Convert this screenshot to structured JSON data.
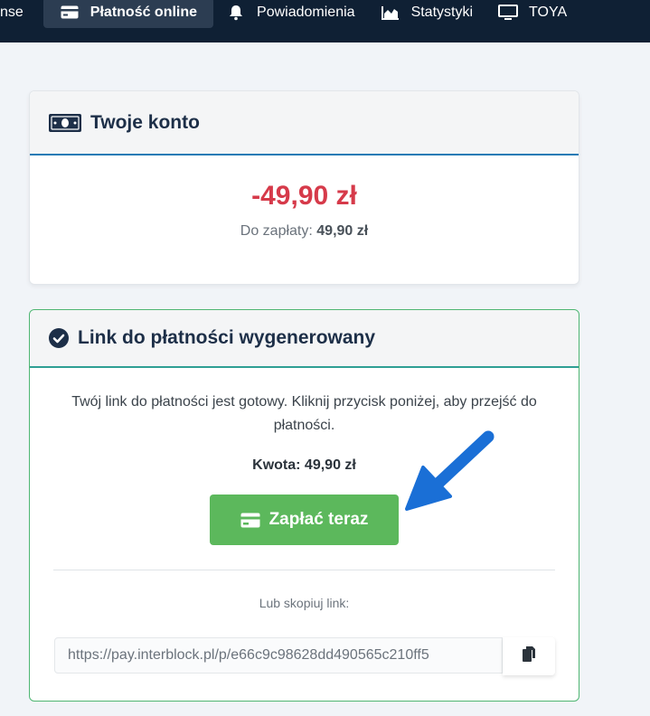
{
  "nav": {
    "items": [
      {
        "label": "nse",
        "icon": "none"
      },
      {
        "label": "Płatność online",
        "icon": "credit-card-icon",
        "active": true
      },
      {
        "label": "Powiadomienia",
        "icon": "bell-icon"
      },
      {
        "label": "Statystyki",
        "icon": "area-chart-icon"
      },
      {
        "label": "TOYA",
        "icon": "monitor-icon"
      }
    ]
  },
  "account": {
    "title": "Twoje konto",
    "balance": "-49,90 zł",
    "due_label": "Do zapłaty:",
    "due_value": "49,90 zł"
  },
  "payment": {
    "title": "Link do płatności wygenerowany",
    "message": "Twój link do płatności jest gotowy. Kliknij przycisk poniżej, aby przejść do płatności.",
    "amount_label": "Kwota:",
    "amount_value": "49,90 zł",
    "pay_button": "Zapłać teraz",
    "copy_label": "Lub skopiuj link:",
    "link_value": "https://pay.interblock.pl/p/e66c9c98628dd490565c210ff5"
  },
  "colors": {
    "nav_bg": "#0f2034",
    "balance_red": "#d63a4a",
    "pay_green": "#5cb85c",
    "accent_blue": "#1f7bb5",
    "arrow_blue": "#1a6fd6"
  }
}
